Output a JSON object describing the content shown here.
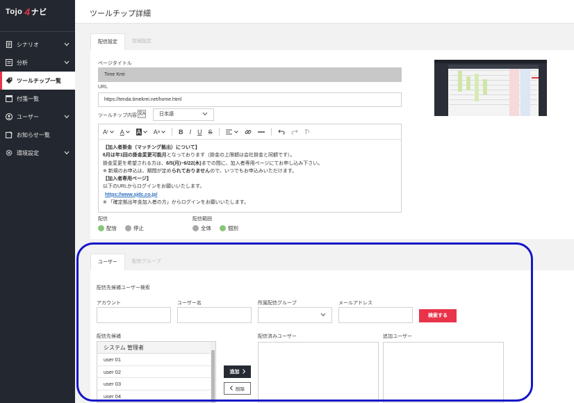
{
  "app": {
    "logo_prefix": "Tojo",
    "logo_number": "4",
    "logo_suffix": "ナビ"
  },
  "sidebar": {
    "items": [
      {
        "label": "シナリオ",
        "icon": "document-icon",
        "chevron": true
      },
      {
        "label": "分析",
        "icon": "list-icon",
        "chevron": true
      },
      {
        "label": "ツールチップ一覧",
        "icon": "tag-icon",
        "chevron": false,
        "active": true
      },
      {
        "label": "付箋一覧",
        "icon": "sticky-note-icon",
        "chevron": false
      },
      {
        "label": "ユーザー",
        "icon": "user-icon",
        "chevron": true
      },
      {
        "label": "お知らせ一覧",
        "icon": "notice-icon",
        "chevron": false
      },
      {
        "label": "環境設定",
        "icon": "gear-icon",
        "chevron": true
      }
    ]
  },
  "header": {
    "title": "ツールチップ詳細"
  },
  "settings_tabs": [
    "配信設定",
    "詳細設定"
  ],
  "form": {
    "page_title_label": "ページタイトル",
    "page_title_value": "Time Krei",
    "url_label": "URL",
    "url_value": "https://tenda.timekrei.net/home.html",
    "content_label": "ツールチップ内容",
    "language_value": "日本語",
    "delivery_label": "配信",
    "delivery_options": [
      "配信",
      "停止"
    ],
    "scope_label": "配信範囲",
    "scope_options": [
      "全体",
      "個別"
    ]
  },
  "toolbar": {
    "font_size": "A",
    "font_color": "A",
    "bg_color": "A",
    "size_x": "A",
    "bold": "B",
    "italic": "I",
    "underline": "U",
    "strike": "S",
    "clear": "T"
  },
  "editor": {
    "line1": "【加入者掛金（マッチング拠出）について】",
    "line2_bold": "6月は年1回の掛金変更可能月",
    "line2_rest": "となっております（掛金の上限額は会社掛金と同額です）。",
    "line3_prefix": "掛金変更を希望される方は、",
    "line3_bold": "6/5(月)~6/22(木)",
    "line3_rest": "までの間に、加入者専用ページにてお申し込み下さい。",
    "line4_prefix": "※ 新規のお申込は、期間が定め",
    "line4_bold": "られておりません",
    "line4_rest": "ので、いつでもお申込みいただけます。",
    "line5": "【加入者専用ページ】",
    "line6": "以下のURLからログインをお願いいたします。",
    "line7": "https://www.sjdc.co.jp/",
    "line8": "※ 「確定拠出年金加入者の方」からログインをお願いいたします。"
  },
  "user_tabs": [
    "ユーザー",
    "配信グループ"
  ],
  "search": {
    "section_title": "配信先候補ユーザー検索",
    "account_label": "アカウント",
    "username_label": "ユーザー名",
    "group_label": "所属配信グループ",
    "email_label": "メールアドレス",
    "search_button": "検索する"
  },
  "lists": {
    "candidates_label": "配信先候補",
    "delivered_label": "配信済みユーザー",
    "added_label": "追加ユーザー",
    "candidates": [
      "システム 管理者",
      "user 01",
      "user 02",
      "user 03",
      "user 04"
    ],
    "add_button": "追加",
    "remove_button": "削除"
  },
  "colors": {
    "accent": "#e8334a",
    "sidebar_bg": "#23272f",
    "radio_on": "#8ac67a",
    "highlight": "#1515c8"
  }
}
